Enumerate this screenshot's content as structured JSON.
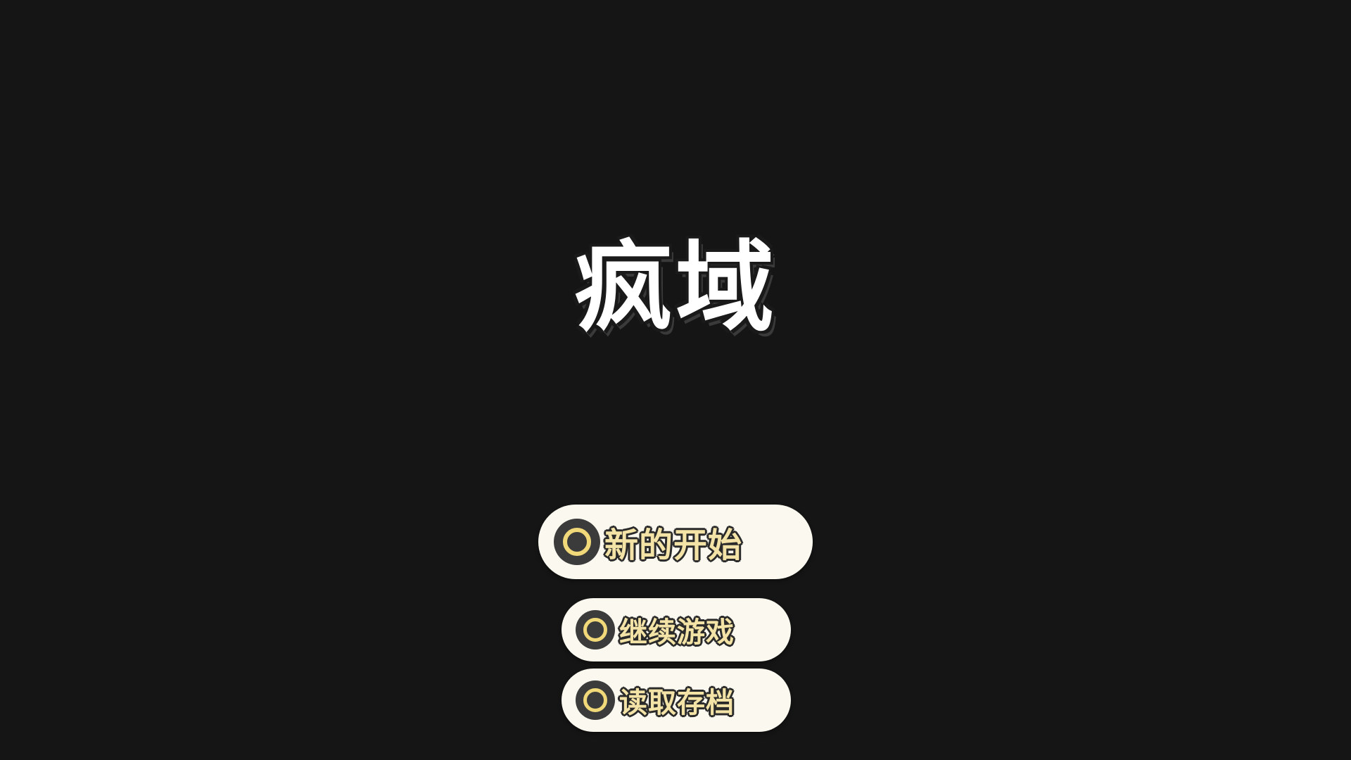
{
  "game": {
    "title": "疯域"
  },
  "menu": {
    "items": [
      {
        "label": "新的开始",
        "icon": "ring-icon"
      },
      {
        "label": "继续游戏",
        "icon": "ring-icon"
      },
      {
        "label": "读取存档",
        "icon": "ring-icon"
      }
    ]
  },
  "colors": {
    "background": "#151515",
    "button_bg": "#faf8ef",
    "label_fill": "#f3e3a6",
    "icon_ring": "#f1d97a",
    "icon_dark": "#3b3b3b",
    "title_fill": "#ffffff"
  }
}
